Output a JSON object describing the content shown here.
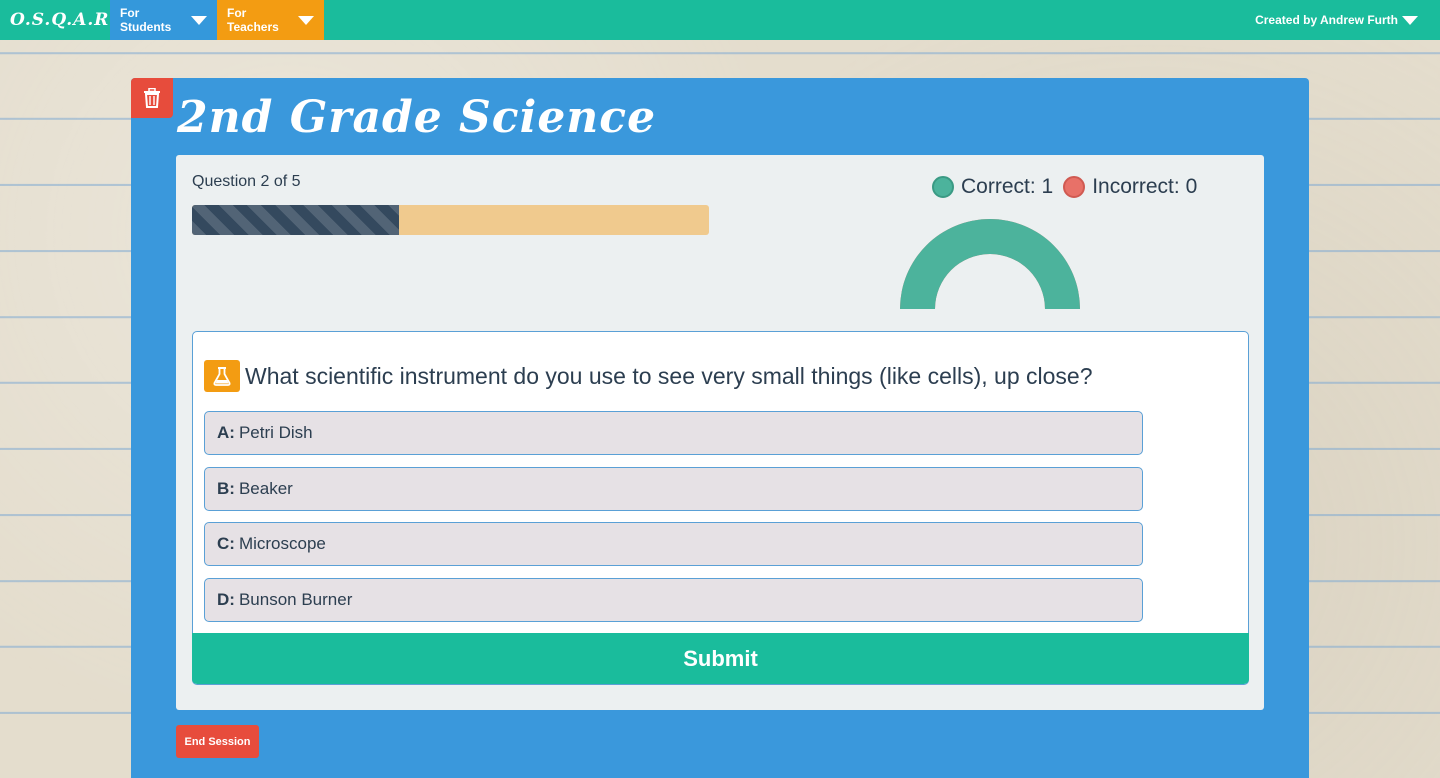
{
  "nav": {
    "brand": "O.S.Q.A.R",
    "students": "For Students",
    "teachers": "For Teachers",
    "user": "Created by Andrew Furth"
  },
  "quiz": {
    "title": "2nd Grade Science",
    "question_count": "Question 2 of 5",
    "progress_fraction": 0.4,
    "correct_label": "Correct: 1",
    "incorrect_label": "Incorrect: 0",
    "correct": 1,
    "incorrect": 0,
    "question": "What scientific instrument do you use to see very small things (like cells), up close?",
    "options": [
      {
        "letter": "A:",
        "text": "Petri Dish"
      },
      {
        "letter": "B:",
        "text": "Beaker"
      },
      {
        "letter": "C:",
        "text": "Microscope"
      },
      {
        "letter": "D:",
        "text": "Bunson Burner"
      }
    ],
    "submit": "Submit",
    "end_session": "End Session"
  },
  "colors": {
    "navbar": "#1abc9c",
    "students": "#3498db",
    "teachers": "#f39c12",
    "panel": "#3a98dc",
    "correct": "#4cb39c",
    "incorrect": "#e87168",
    "danger": "#e74c3c"
  },
  "icons": {
    "trash": "trash-icon",
    "flask": "flask-icon",
    "caret": "caret-down-icon"
  }
}
